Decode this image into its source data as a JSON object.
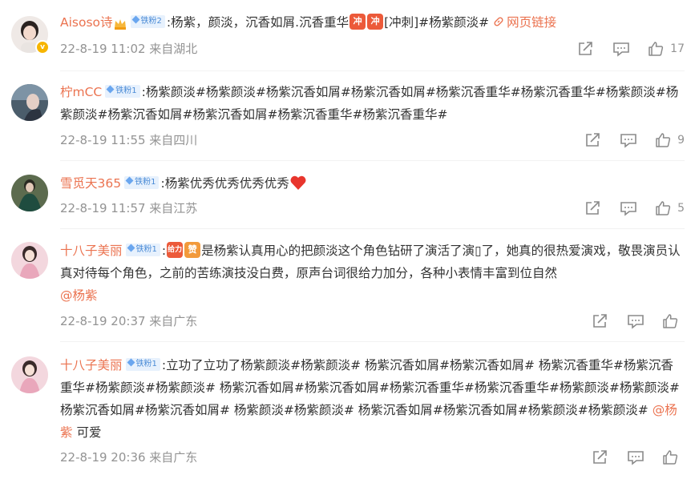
{
  "comments": [
    {
      "username": "Aisoso诗",
      "badge": "铁粉2",
      "colon": ":",
      "text_a": "杨紫，颜淡，沉香如屑.沉香重华",
      "sticker1": "冲",
      "sticker2": "冲",
      "text_b": "[冲刺]#杨紫颜淡#",
      "link_text": "网页链接",
      "time": "22-8-19 11:02 来自湖北",
      "likes": "17"
    },
    {
      "username": "柠mCC",
      "badge": "铁粉1",
      "colon": ":",
      "text_a": "杨紫颜淡#杨紫颜淡#杨紫沉香如屑#杨紫沉香如屑#杨紫沉香重华#杨紫沉香重华#杨紫颜淡#杨紫颜淡#杨紫沉香如屑#杨紫沉香如屑#杨紫沉香重华#杨紫沉香重华#",
      "time": "22-8-19 11:55 来自四川",
      "likes": "9"
    },
    {
      "username": "雪觅天365",
      "badge": "铁粉1",
      "colon": ":",
      "text_a": "杨紫优秀优秀优秀优秀",
      "time": "22-8-19 11:57 来自江苏",
      "likes": "5"
    },
    {
      "username": "十八子美丽",
      "badge": "铁粉1",
      "colon": ":",
      "sticker1": "给力",
      "sticker2": "赞",
      "text_a": "是杨紫认真用心的把颜淡这个角色钻研了演活了演▯了，她真的很热爱演戏，敬畏演员认真对待每个角色，之前的苦练演技没白费，原声台词很给力加分，各种小表情丰富到位自然",
      "mention": "@杨紫",
      "time": "22-8-19 20:37 来自广东",
      "likes": ""
    },
    {
      "username": "十八子美丽",
      "badge": "铁粉1",
      "colon": ":",
      "text_a": "立功了立功了杨紫颜淡#杨紫颜淡# 杨紫沉香如屑#杨紫沉香如屑# 杨紫沉香重华#杨紫沉香重华#杨紫颜淡#杨紫颜淡# 杨紫沉香如屑#杨紫沉香如屑#杨紫沉香重华#杨紫沉香重华#杨紫颜淡#杨紫颜淡# 杨紫沉香如屑#杨紫沉香如屑# 杨紫颜淡#杨紫颜淡# 杨紫沉香如屑#杨紫沉香如屑#杨紫颜淡#杨紫颜淡#",
      "mention": "@杨紫",
      "text_c": "可爱",
      "time": "22-8-19 20:36 来自广东",
      "likes": ""
    }
  ],
  "colors": {
    "username": "#eb7350",
    "meta": "#939393",
    "badge_bg": "#e7f1fd",
    "badge_fg": "#4a8bd6"
  },
  "icons": [
    "share-icon",
    "comment-icon",
    "like-icon",
    "link-icon",
    "heart-icon",
    "crown-icon",
    "verified-icon"
  ]
}
